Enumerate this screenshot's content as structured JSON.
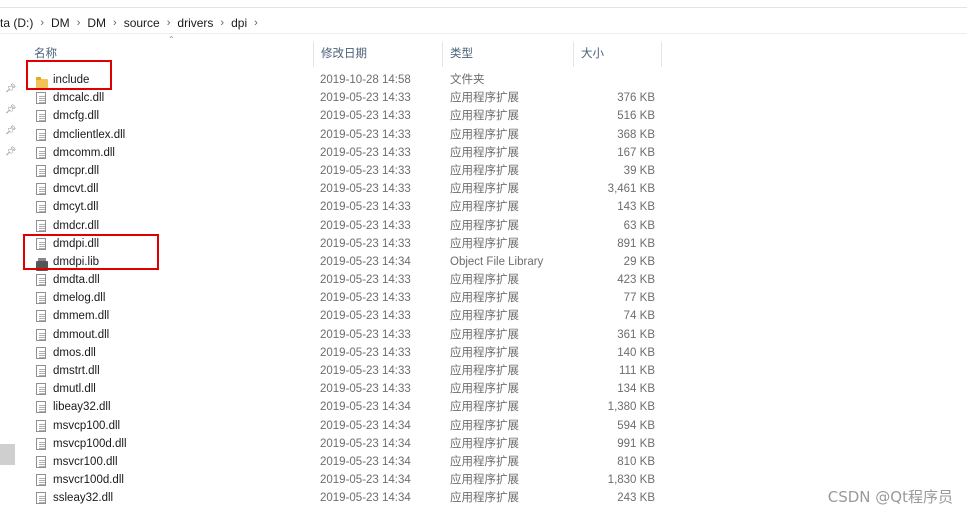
{
  "ribbon": {
    "labels": [
      "",
      ""
    ]
  },
  "breadcrumb": {
    "items": [
      "ta (D:)",
      "DM",
      "DM",
      "source",
      "drivers",
      "dpi"
    ],
    "separator": "›"
  },
  "columns": {
    "name": "名称",
    "date": "修改日期",
    "type": "类型",
    "size": "大小"
  },
  "files": [
    {
      "name": "include",
      "date": "2019-10-28 14:58",
      "type": "文件夹",
      "size": "",
      "icon": "folder-icon"
    },
    {
      "name": "dmcalc.dll",
      "date": "2019-05-23 14:33",
      "type": "应用程序扩展",
      "size": "376 KB",
      "icon": "dll-file-icon"
    },
    {
      "name": "dmcfg.dll",
      "date": "2019-05-23 14:33",
      "type": "应用程序扩展",
      "size": "516 KB",
      "icon": "dll-file-icon"
    },
    {
      "name": "dmclientlex.dll",
      "date": "2019-05-23 14:33",
      "type": "应用程序扩展",
      "size": "368 KB",
      "icon": "dll-file-icon"
    },
    {
      "name": "dmcomm.dll",
      "date": "2019-05-23 14:33",
      "type": "应用程序扩展",
      "size": "167 KB",
      "icon": "dll-file-icon"
    },
    {
      "name": "dmcpr.dll",
      "date": "2019-05-23 14:33",
      "type": "应用程序扩展",
      "size": "39 KB",
      "icon": "dll-file-icon"
    },
    {
      "name": "dmcvt.dll",
      "date": "2019-05-23 14:33",
      "type": "应用程序扩展",
      "size": "3,461 KB",
      "icon": "dll-file-icon"
    },
    {
      "name": "dmcyt.dll",
      "date": "2019-05-23 14:33",
      "type": "应用程序扩展",
      "size": "143 KB",
      "icon": "dll-file-icon"
    },
    {
      "name": "dmdcr.dll",
      "date": "2019-05-23 14:33",
      "type": "应用程序扩展",
      "size": "63 KB",
      "icon": "dll-file-icon"
    },
    {
      "name": "dmdpi.dll",
      "date": "2019-05-23 14:33",
      "type": "应用程序扩展",
      "size": "891 KB",
      "icon": "dll-file-icon"
    },
    {
      "name": "dmdpi.lib",
      "date": "2019-05-23 14:34",
      "type": "Object File Library",
      "size": "29 KB",
      "icon": "lib-file-icon"
    },
    {
      "name": "dmdta.dll",
      "date": "2019-05-23 14:33",
      "type": "应用程序扩展",
      "size": "423 KB",
      "icon": "dll-file-icon"
    },
    {
      "name": "dmelog.dll",
      "date": "2019-05-23 14:33",
      "type": "应用程序扩展",
      "size": "77 KB",
      "icon": "dll-file-icon"
    },
    {
      "name": "dmmem.dll",
      "date": "2019-05-23 14:33",
      "type": "应用程序扩展",
      "size": "74 KB",
      "icon": "dll-file-icon"
    },
    {
      "name": "dmmout.dll",
      "date": "2019-05-23 14:33",
      "type": "应用程序扩展",
      "size": "361 KB",
      "icon": "dll-file-icon"
    },
    {
      "name": "dmos.dll",
      "date": "2019-05-23 14:33",
      "type": "应用程序扩展",
      "size": "140 KB",
      "icon": "dll-file-icon"
    },
    {
      "name": "dmstrt.dll",
      "date": "2019-05-23 14:33",
      "type": "应用程序扩展",
      "size": "111 KB",
      "icon": "dll-file-icon"
    },
    {
      "name": "dmutl.dll",
      "date": "2019-05-23 14:33",
      "type": "应用程序扩展",
      "size": "134 KB",
      "icon": "dll-file-icon"
    },
    {
      "name": "libeay32.dll",
      "date": "2019-05-23 14:34",
      "type": "应用程序扩展",
      "size": "1,380 KB",
      "icon": "dll-file-icon"
    },
    {
      "name": "msvcp100.dll",
      "date": "2019-05-23 14:34",
      "type": "应用程序扩展",
      "size": "594 KB",
      "icon": "dll-file-icon"
    },
    {
      "name": "msvcp100d.dll",
      "date": "2019-05-23 14:34",
      "type": "应用程序扩展",
      "size": "991 KB",
      "icon": "dll-file-icon"
    },
    {
      "name": "msvcr100.dll",
      "date": "2019-05-23 14:34",
      "type": "应用程序扩展",
      "size": "810 KB",
      "icon": "dll-file-icon"
    },
    {
      "name": "msvcr100d.dll",
      "date": "2019-05-23 14:34",
      "type": "应用程序扩展",
      "size": "1,830 KB",
      "icon": "dll-file-icon"
    },
    {
      "name": "ssleay32.dll",
      "date": "2019-05-23 14:34",
      "type": "应用程序扩展",
      "size": "243 KB",
      "icon": "dll-file-icon"
    }
  ],
  "annotation_color": "#e00000",
  "watermark": "CSDN @Qt程序员"
}
